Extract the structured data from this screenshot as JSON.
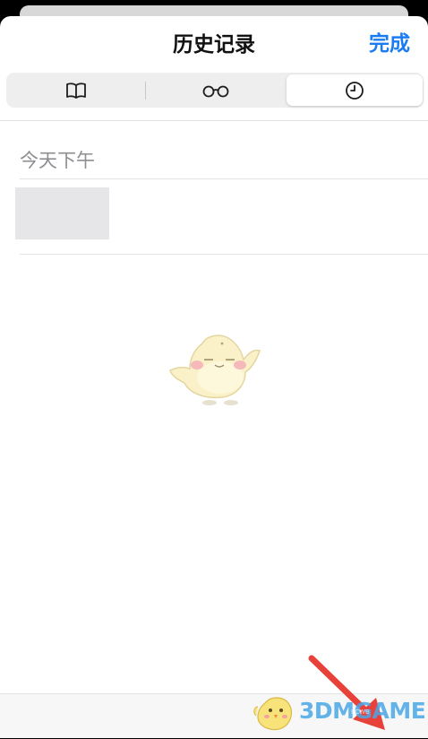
{
  "header": {
    "title": "历史记录",
    "done_label": "完成"
  },
  "tabs": [
    {
      "name": "bookmarks",
      "icon": "book-icon",
      "selected": false
    },
    {
      "name": "reading-list",
      "icon": "glasses-icon",
      "selected": false
    },
    {
      "name": "history",
      "icon": "clock-icon",
      "selected": true
    }
  ],
  "history": {
    "section_label": "今天下午",
    "items": [
      {
        "thumbnail": "placeholder"
      }
    ]
  },
  "watermark": {
    "text": "3DMGAME",
    "sub": "PCWB"
  },
  "colors": {
    "accent": "#1a7cf0",
    "text": "#111111",
    "secondary_text": "#8e8e93",
    "annotation_arrow": "#e8413a"
  }
}
